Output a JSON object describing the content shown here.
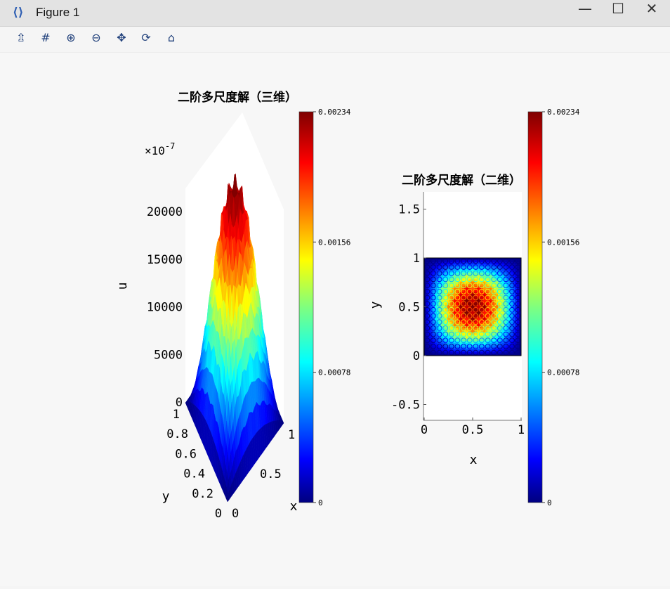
{
  "window": {
    "title": "Figure 1",
    "app_icon": "figure-app-icon"
  },
  "window_controls": {
    "minimize": "—",
    "maximize": "☐",
    "close": "✕"
  },
  "toolbar": [
    {
      "name": "save-icon",
      "glyph": "⇫"
    },
    {
      "name": "grid-icon",
      "glyph": "#"
    },
    {
      "name": "zoom-in-icon",
      "glyph": "⊕"
    },
    {
      "name": "zoom-out-icon",
      "glyph": "⊖"
    },
    {
      "name": "pan-icon",
      "glyph": "✥"
    },
    {
      "name": "rotate-icon",
      "glyph": "⟳"
    },
    {
      "name": "home-icon",
      "glyph": "⌂"
    }
  ],
  "chart_data": [
    {
      "type": "surface",
      "title": "二阶多尺度解（三维）",
      "scale_exponent_label": "×10",
      "scale_exponent": "-7",
      "zlabel": "u",
      "xlabel": "x",
      "ylabel": "y",
      "z_ticks": [
        "0",
        "5000",
        "10000",
        "15000",
        "20000"
      ],
      "z_range": [
        0,
        23400
      ],
      "x_ticks": [
        "0",
        "0.5",
        "1"
      ],
      "y_ticks": [
        "0",
        "0.2",
        "0.4",
        "0.6",
        "0.8",
        "1"
      ],
      "colormap": "jet",
      "colorbar": {
        "ticks": [
          "0",
          "0.00078",
          "0.00156",
          "0.00234"
        ],
        "range": [
          0,
          0.00234
        ]
      },
      "description_peak_value": 23400
    },
    {
      "type": "heatmap",
      "title": "二阶多尺度解（二维）",
      "xlabel": "x",
      "ylabel": "y",
      "x_ticks": [
        "0",
        "0.5",
        "1"
      ],
      "y_ticks": [
        "-0.5",
        "0",
        "0.5",
        "1",
        "1.5"
      ],
      "xlim": [
        0,
        1
      ],
      "ylim": [
        -0.65,
        1.65
      ],
      "data_extent": {
        "x": [
          0,
          1
        ],
        "y": [
          0,
          1
        ]
      },
      "colormap": "jet",
      "colorbar": {
        "ticks": [
          "0",
          "0.00078",
          "0.00156",
          "0.00234"
        ],
        "range": [
          0,
          0.00234
        ]
      }
    }
  ],
  "colors": {
    "titlebar": "#e3e3e3",
    "background": "#f7f7f7",
    "axes_bg": "#ffffff"
  }
}
